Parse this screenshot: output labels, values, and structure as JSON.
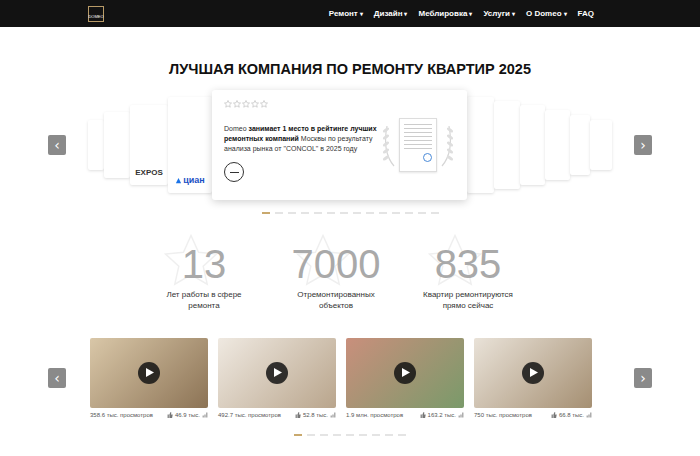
{
  "header": {
    "logo": "DOMEO",
    "nav": [
      {
        "label": "Ремонт",
        "caret": "▾"
      },
      {
        "label": "Дизайн",
        "caret": "▾"
      },
      {
        "label": "Меблировка",
        "caret": "▾"
      },
      {
        "label": "Услуги",
        "caret": "▾"
      },
      {
        "label": "О Domeo",
        "caret": "▾"
      },
      {
        "label": "FAQ"
      }
    ]
  },
  "title": "ЛУЧШАЯ КОМПАНИЯ ПО РЕМОНТУ КВАРТИР 2025",
  "awards": {
    "prev": "‹",
    "next": "›",
    "left_cards": [
      {
        "kind": "blank"
      },
      {
        "kind": "blank"
      },
      {
        "kind": "logo",
        "logo": "EXPOS"
      },
      {
        "kind": "logo",
        "logo": "циан"
      }
    ],
    "main_card": {
      "stars": 0,
      "text_before": "Domeo ",
      "text_bold": "занимает 1 место в рейтинге лучших ремонтных компаний",
      "text_after": " Москвы по результату анализа рынка от \"CONCOL\" в 2025 году"
    },
    "right_cards": [
      {
        "kind": "blank"
      },
      {
        "kind": "blank"
      },
      {
        "kind": "blank"
      },
      {
        "kind": "blank"
      },
      {
        "kind": "blank"
      },
      {
        "kind": "blank"
      }
    ],
    "dots": [
      {
        "selected": true
      },
      {
        "selected": false
      },
      {
        "selected": false
      },
      {
        "selected": false
      },
      {
        "selected": false
      },
      {
        "selected": false
      },
      {
        "selected": false
      },
      {
        "selected": false
      },
      {
        "selected": false
      },
      {
        "selected": false
      },
      {
        "selected": false
      },
      {
        "selected": false
      },
      {
        "selected": false
      },
      {
        "selected": false
      }
    ]
  },
  "stats": [
    {
      "value": "13",
      "label": "Лет работы в сфере ремонта"
    },
    {
      "value": "7000",
      "label": "Отремонтированных объектов"
    },
    {
      "value": "835",
      "label": "Квартир ремонтируются прямо сейчас"
    }
  ],
  "videos": {
    "prev": "‹",
    "next": "›",
    "items": [
      {
        "views": "358.6 тыс. просмотров",
        "likes": "46.9 тыс."
      },
      {
        "views": "492.7 тыс. просмотров",
        "likes": "52.8 тыс."
      },
      {
        "views": "1.9 млн. просмотров",
        "likes": "163.2 тыс."
      },
      {
        "views": "750 тыс. просмотров",
        "likes": "66.8 тыс."
      }
    ],
    "dots": [
      {
        "selected": true
      },
      {
        "selected": false
      },
      {
        "selected": false
      },
      {
        "selected": false
      },
      {
        "selected": false
      },
      {
        "selected": false
      },
      {
        "selected": false
      },
      {
        "selected": false
      },
      {
        "selected": false
      }
    ]
  }
}
